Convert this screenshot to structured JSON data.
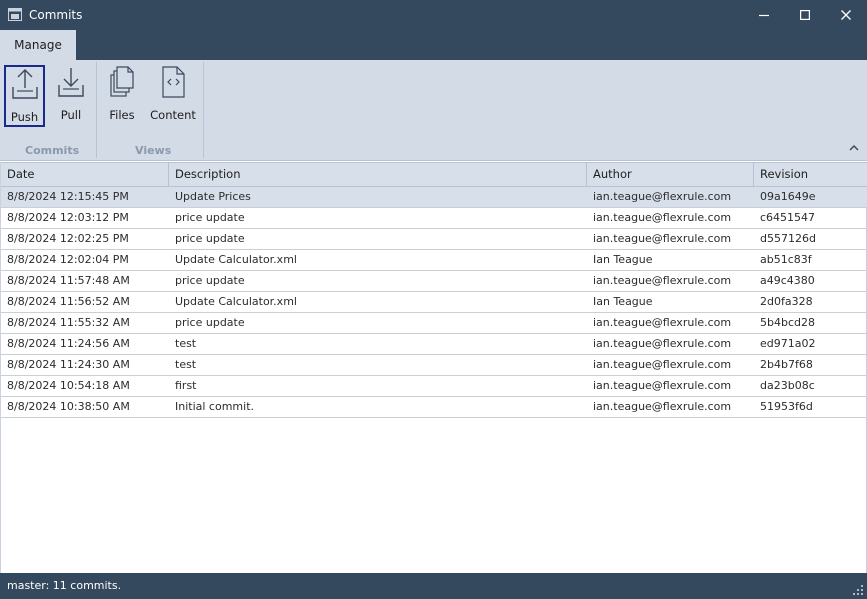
{
  "window": {
    "title": "Commits",
    "icon": "window-app-icon",
    "controls": [
      "minimize-icon",
      "maximize-icon",
      "close-icon"
    ]
  },
  "ribbon": {
    "tab": "Manage",
    "groups": [
      {
        "label": "Commits",
        "buttons": [
          {
            "label": "Push",
            "icon": "push-upload-icon"
          },
          {
            "label": "Pull",
            "icon": "pull-download-icon"
          }
        ]
      },
      {
        "label": "Views",
        "buttons": [
          {
            "label": "Files",
            "icon": "files-icon"
          },
          {
            "label": "Content",
            "icon": "content-code-icon"
          }
        ]
      }
    ]
  },
  "grid": {
    "columns": [
      "Date",
      "Description",
      "Author",
      "Revision"
    ],
    "rows": [
      {
        "date": "8/8/2024 12:15:45 PM",
        "description": "Update Prices",
        "author": "ian.teague@flexrule.com",
        "revision": "09a1649e"
      },
      {
        "date": "8/8/2024 12:03:12 PM",
        "description": "price update",
        "author": "ian.teague@flexrule.com",
        "revision": "c6451547"
      },
      {
        "date": "8/8/2024 12:02:25 PM",
        "description": "price update",
        "author": "ian.teague@flexrule.com",
        "revision": "d557126d"
      },
      {
        "date": "8/8/2024 12:02:04 PM",
        "description": "Update Calculator.xml",
        "author": "Ian Teague",
        "revision": "ab51c83f"
      },
      {
        "date": "8/8/2024 11:57:48 AM",
        "description": "price update",
        "author": "ian.teague@flexrule.com",
        "revision": "a49c4380"
      },
      {
        "date": "8/8/2024 11:56:52 AM",
        "description": "Update Calculator.xml",
        "author": "Ian Teague",
        "revision": "2d0fa328"
      },
      {
        "date": "8/8/2024 11:55:32 AM",
        "description": "price update",
        "author": "ian.teague@flexrule.com",
        "revision": "5b4bcd28"
      },
      {
        "date": "8/8/2024 11:24:56 AM",
        "description": "test",
        "author": "ian.teague@flexrule.com",
        "revision": "ed971a02"
      },
      {
        "date": "8/8/2024 11:24:30 AM",
        "description": "test",
        "author": "ian.teague@flexrule.com",
        "revision": "2b4b7f68"
      },
      {
        "date": "8/8/2024 10:54:18 AM",
        "description": "first",
        "author": "ian.teague@flexrule.com",
        "revision": "da23b08c"
      },
      {
        "date": "8/8/2024 10:38:50 AM",
        "description": "Initial commit.",
        "author": "ian.teague@flexrule.com",
        "revision": "51953f6d"
      }
    ]
  },
  "status": {
    "text": "master: 11 commits."
  },
  "colors": {
    "titlebar": "#34495e",
    "ribbon": "#d3dbe7",
    "selection_border": "#1b2a8a",
    "row_selected": "#d7dfea"
  }
}
